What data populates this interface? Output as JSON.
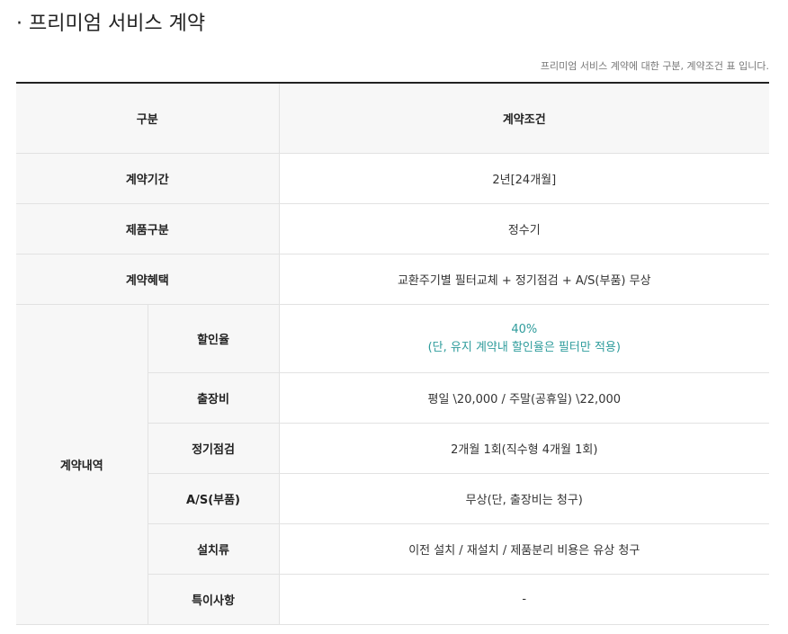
{
  "page_title": "· 프리미엄 서비스 계약",
  "caption": "프리미엄 서비스 계약에 대한 구분, 계약조건 표 입니다.",
  "table": {
    "header": {
      "col1": "구분",
      "col2": "계약조건"
    },
    "rows": [
      {
        "label": "계약기간",
        "value": "2년[24개월]"
      },
      {
        "label": "제품구분",
        "value": "정수기"
      },
      {
        "label": "계약혜택",
        "value": "교환주기별 필터교체 + 정기점검 + A/S(부품) 무상"
      }
    ],
    "group": {
      "label": "계약내역",
      "rows": [
        {
          "label": "할인율",
          "value_line1": "40%",
          "value_line2": "(단, 유지 계약내 할인율은 필터만 적용)"
        },
        {
          "label": "출장비",
          "value": "평일 \\20,000 / 주말(공휴일) \\22,000"
        },
        {
          "label": "정기점검",
          "value": "2개월 1회(직수형 4개월 1회)"
        },
        {
          "label": "A/S(부품)",
          "value": "무상(단, 출장비는 청구)"
        },
        {
          "label": "설치류",
          "value": "이전 설치 / 재설치 / 제품분리 비용은 유상 청구"
        },
        {
          "label": "특이사항",
          "value": "-"
        }
      ]
    }
  },
  "colors": {
    "accent": "#2f9c9c",
    "header_bg": "#f7f7f7",
    "border": "#e2e2e2",
    "top_rule": "#222222"
  }
}
